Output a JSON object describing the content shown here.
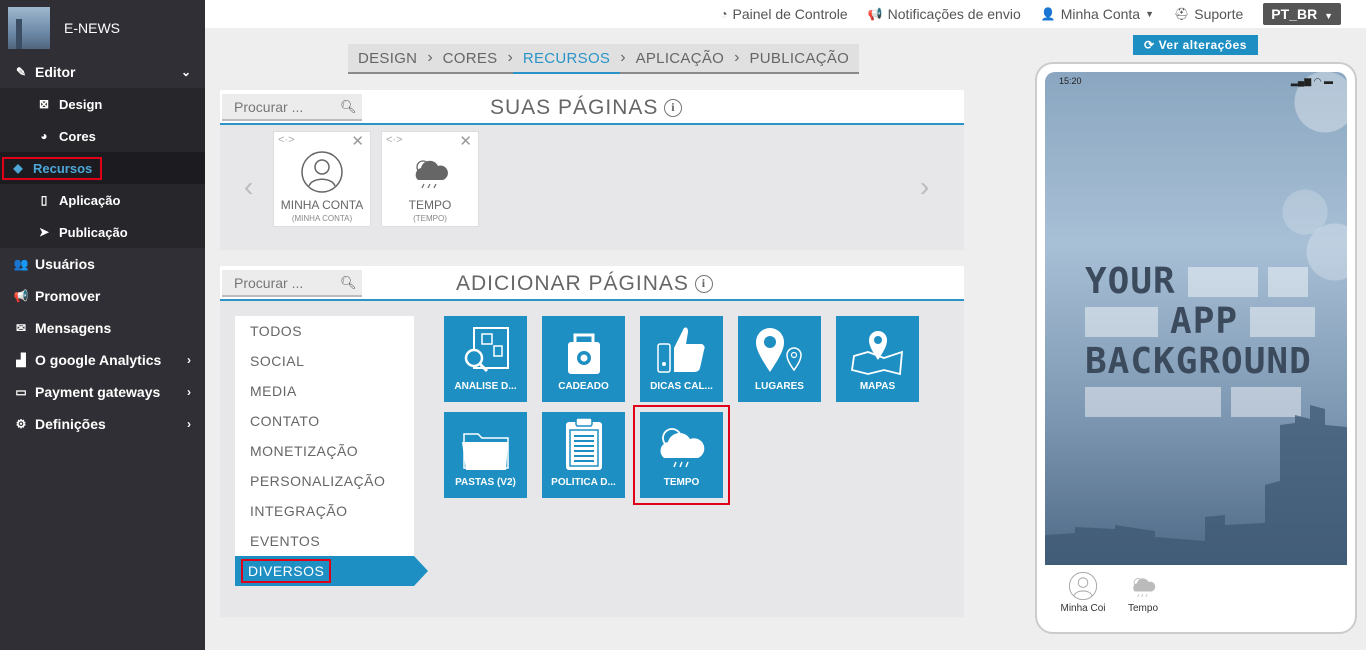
{
  "brand": {
    "name": "E-NEWS"
  },
  "sidebar": {
    "items": [
      {
        "label": "Editor",
        "icon": "pencil-icon",
        "expanded": true
      },
      {
        "label": "Usuários",
        "icon": "users-icon"
      },
      {
        "label": "Promover",
        "icon": "megaphone-icon"
      },
      {
        "label": "Mensagens",
        "icon": "envelope-icon"
      },
      {
        "label": "O google Analytics",
        "icon": "bar-chart-icon"
      },
      {
        "label": "Payment gateways",
        "icon": "credit-card-icon"
      },
      {
        "label": "Definições",
        "icon": "cogs-icon"
      }
    ],
    "editor_sub": [
      {
        "label": "Design",
        "icon": "design-icon"
      },
      {
        "label": "Cores",
        "icon": "palette-icon"
      },
      {
        "label": "Recursos",
        "icon": "cube-icon",
        "active": true
      },
      {
        "label": "Aplicação",
        "icon": "mobile-icon"
      },
      {
        "label": "Publicação",
        "icon": "paper-plane-icon"
      }
    ]
  },
  "topbar": {
    "dashboard": "Painel de Controle",
    "notifications": "Notificações de envio",
    "account": "Minha Conta",
    "support": "Suporte",
    "language": "PT_BR"
  },
  "wizard": {
    "steps": [
      "DESIGN",
      "CORES",
      "RECURSOS",
      "APLICAÇÃO",
      "PUBLICAÇÃO"
    ],
    "active": "RECURSOS"
  },
  "your_pages": {
    "title": "SUAS PÁGINAS",
    "search_placeholder": "Procurar ...",
    "cards": [
      {
        "name": "MINHA CONTA",
        "sub": "(MINHA CONTA)"
      },
      {
        "name": "TEMPO",
        "sub": "(TEMPO)"
      }
    ]
  },
  "add_pages": {
    "title": "ADICIONAR PÁGINAS",
    "search_placeholder": "Procurar ...",
    "categories": [
      "TODOS",
      "SOCIAL",
      "MEDIA",
      "CONTATO",
      "MONETIZAÇÃO",
      "PERSONALIZAÇÃO",
      "INTEGRAÇÃO",
      "EVENTOS",
      "DIVERSOS"
    ],
    "active_category": "DIVERSOS",
    "tiles": [
      "ANÁLISE D...",
      "CADEADO",
      "DICAS CAL...",
      "LUGARES",
      "MAPAS",
      "PASTAS (V2)",
      "POLÍTICA D...",
      "TEMPO"
    ]
  },
  "preview": {
    "button": "Ver alterações",
    "time": "15:20",
    "bg_lines": [
      "YOUR",
      "APP",
      "BACKGROUND"
    ],
    "tabs": [
      "Minha Coi",
      "Tempo"
    ]
  },
  "colors": {
    "accent": "#1e8fc3",
    "sidebar": "#2f2f35",
    "highlight": "#e0001a"
  }
}
